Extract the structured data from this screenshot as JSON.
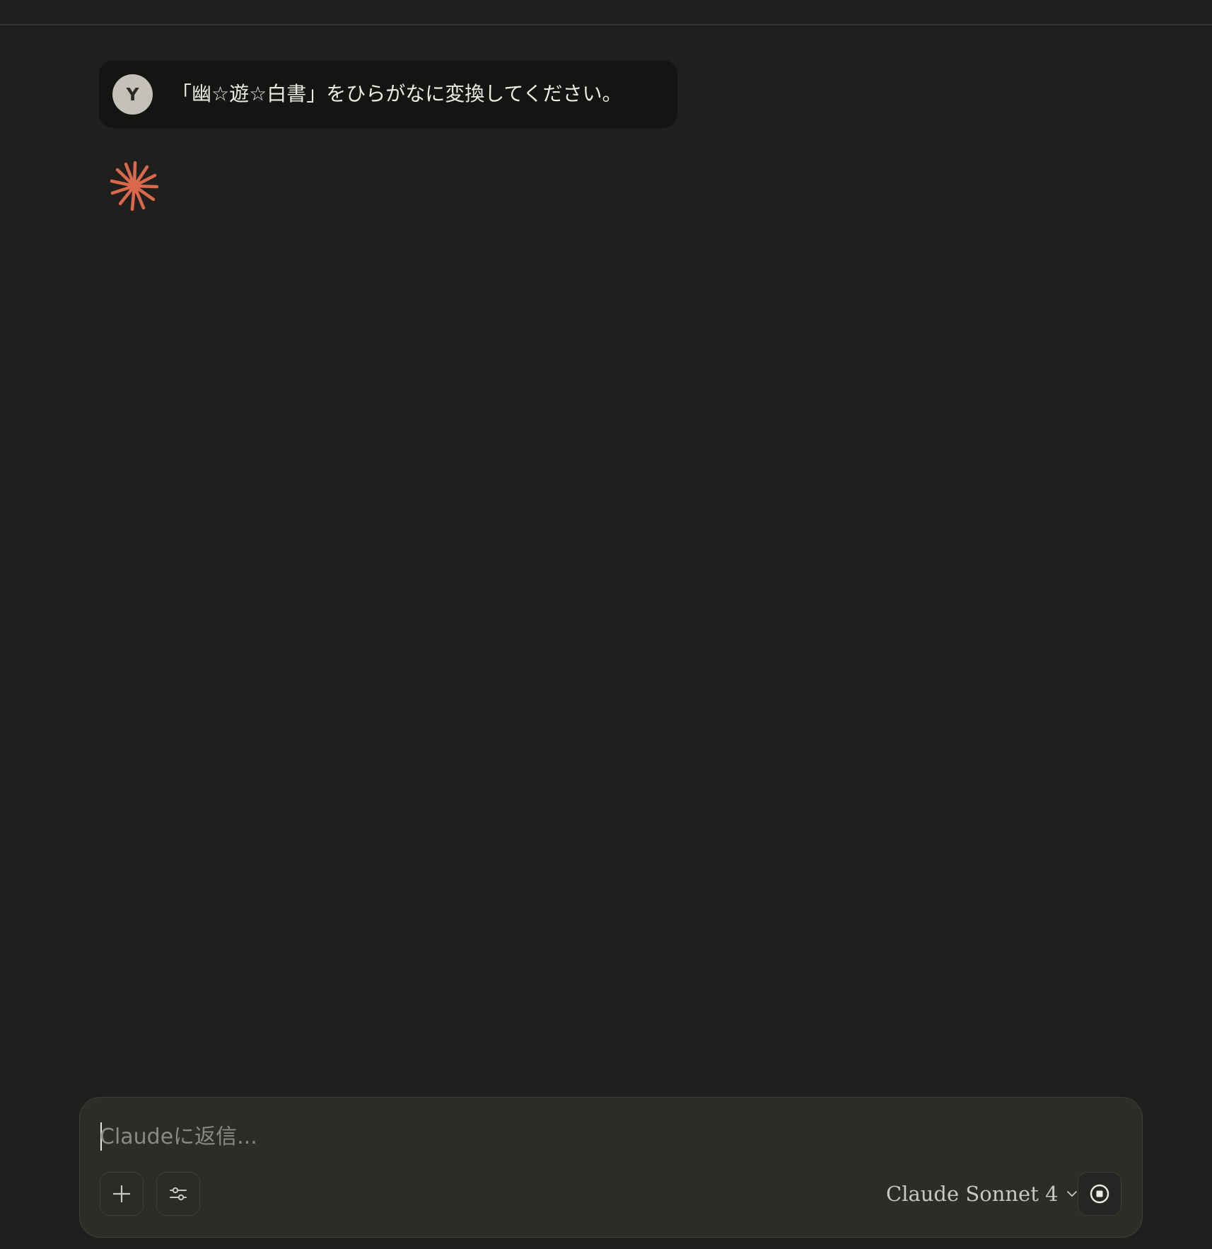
{
  "conversation": {
    "user_message": {
      "avatar_initial": "Y",
      "text": "「幽☆遊☆白書」をひらがなに変換してください。"
    },
    "assistant": {
      "status_icon": "claude-spark-icon",
      "accent_color": "#d9694a"
    }
  },
  "composer": {
    "placeholder": "Claudeに返信...",
    "value": "",
    "add_icon": "plus-icon",
    "tools_icon": "sliders-icon",
    "model_label": "Claude Sonnet 4",
    "model_icon": "chevron-down-icon",
    "stop_icon": "stop-icon"
  },
  "colors": {
    "background": "#1f1f1e",
    "user_bubble": "#141413",
    "composer_bg": "#2c2c29",
    "text": "#ecebe5"
  }
}
